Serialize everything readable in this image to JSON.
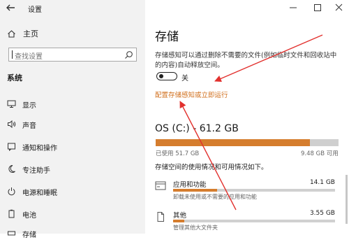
{
  "window": {
    "title": "设置"
  },
  "sidebar": {
    "home_label": "主页",
    "search_placeholder": "查找设置",
    "section_label": "系统",
    "items": [
      {
        "label": "显示",
        "icon": "monitor-icon"
      },
      {
        "label": "声音",
        "icon": "speaker-icon"
      },
      {
        "label": "通知和操作",
        "icon": "notification-icon"
      },
      {
        "label": "专注助手",
        "icon": "moon-icon"
      },
      {
        "label": "电源和睡眠",
        "icon": "power-icon"
      },
      {
        "label": "电池",
        "icon": "battery-icon"
      },
      {
        "label": "存储",
        "icon": "storage-icon"
      }
    ]
  },
  "main": {
    "title": "存储",
    "description": "存储感知可以通过删除不需要的文件(例如临时文件和回收站中的内容)自动释放空间。",
    "toggle_label": "关",
    "configure_link": "配置存储感知或立即运行",
    "drive": {
      "name": "OS (C:) - 61.2 GB",
      "used_label": "已使用 51.7 GB",
      "free_label": "9.48 GB 可用",
      "used_fraction": 0.845
    },
    "usage_description": "存储空间的使用情况和可用情况如下。",
    "categories": [
      {
        "name": "应用和功能",
        "size": "14.1 GB",
        "sub": "卸载未使用或不需要的应用和功能",
        "fraction": 0.27,
        "icon": "apps-icon"
      },
      {
        "name": "其他",
        "size": "3.55 GB",
        "sub": "管理其他大文件夹",
        "fraction": 0.07,
        "icon": "document-icon"
      }
    ]
  },
  "colors": {
    "accent": "#d57d2e",
    "link": "#d1701e",
    "annotation": "#e2312e"
  }
}
